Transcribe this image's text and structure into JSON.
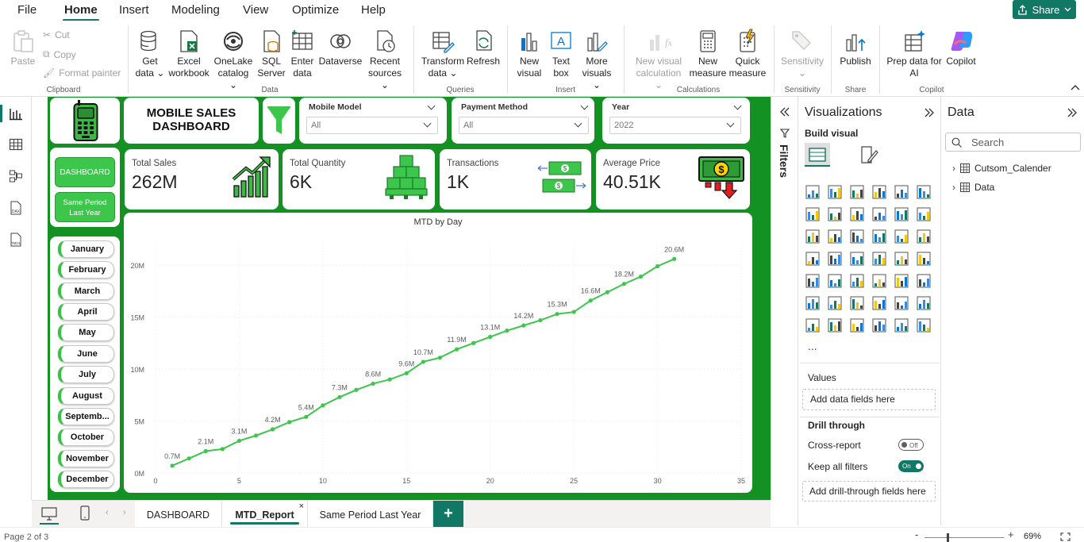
{
  "menu": {
    "items": [
      "File",
      "Home",
      "Insert",
      "Modeling",
      "View",
      "Optimize",
      "Help"
    ],
    "share_label": "Share"
  },
  "ribbon": {
    "clipboard": {
      "paste": "Paste",
      "cut": "Cut",
      "copy": "Copy",
      "format_painter": "Format painter",
      "label": "Clipboard"
    },
    "data": {
      "get_data": [
        "Get",
        "data"
      ],
      "excel": [
        "Excel",
        "workbook"
      ],
      "onelake": [
        "OneLake",
        "catalog"
      ],
      "sql": [
        "SQL",
        "Server"
      ],
      "enter": [
        "Enter",
        "data"
      ],
      "dataverse": [
        "Dataverse"
      ],
      "recent": [
        "Recent",
        "sources"
      ],
      "label": "Data"
    },
    "queries": {
      "transform": [
        "Transform",
        "data"
      ],
      "refresh": [
        "Refresh"
      ],
      "label": "Queries"
    },
    "insert": {
      "new_visual": [
        "New",
        "visual"
      ],
      "text_box": [
        "Text",
        "box"
      ],
      "more_visuals": [
        "More",
        "visuals"
      ],
      "label": "Insert"
    },
    "calculations": {
      "new_visual_calc": [
        "New visual",
        "calculation"
      ],
      "new_measure": [
        "New",
        "measure"
      ],
      "quick_measure": [
        "Quick",
        "measure"
      ],
      "label": "Calculations"
    },
    "sensitivity": {
      "btn": [
        "Sensitivity"
      ],
      "label": "Sensitivity"
    },
    "share": {
      "publish": [
        "Publish"
      ],
      "label": "Share"
    },
    "copilot": {
      "prep": [
        "Prep data for",
        "AI"
      ],
      "copilot": [
        "Copilot"
      ],
      "label": "Copilot"
    }
  },
  "dashboard": {
    "title_line1": "MOBILE SALES",
    "title_line2": "DASHBOARD",
    "slicers": [
      {
        "title": "Mobile Model",
        "value": "All"
      },
      {
        "title": "Payment Method",
        "value": "All"
      },
      {
        "title": "Year",
        "value": "2022"
      }
    ],
    "nav_buttons": {
      "dashboard": "DASHBOARD",
      "same_period_1": "Same Period",
      "same_period_2": "Last Year"
    },
    "kpis": [
      {
        "label": "Total Sales",
        "value": "262M"
      },
      {
        "label": "Total Quantity",
        "value": "6K"
      },
      {
        "label": "Transactions",
        "value": "1K"
      },
      {
        "label": "Average Price",
        "value": "40.51K"
      }
    ],
    "months": [
      "January",
      "February",
      "March",
      "April",
      "May",
      "June",
      "July",
      "August",
      "Septemb...",
      "October",
      "November",
      "December"
    ],
    "colors": {
      "accent": "#139122",
      "line": "#3cc64b",
      "button": "#3cc64b"
    }
  },
  "chart_data": {
    "type": "line",
    "title": "MTD by Day",
    "x": [
      1,
      2,
      3,
      4,
      5,
      6,
      7,
      8,
      9,
      10,
      11,
      12,
      13,
      14,
      15,
      16,
      17,
      18,
      19,
      20,
      21,
      22,
      23,
      24,
      25,
      26,
      27,
      28,
      29,
      30,
      31
    ],
    "series": [
      {
        "values": [
          0.7,
          1.4,
          2.1,
          2.3,
          3.1,
          3.6,
          4.2,
          4.9,
          5.4,
          6.5,
          7.3,
          8.0,
          8.6,
          9.0,
          9.6,
          10.7,
          11.1,
          11.9,
          12.5,
          13.1,
          13.7,
          14.2,
          14.7,
          15.3,
          15.5,
          16.6,
          17.4,
          18.2,
          18.9,
          19.9,
          20.6
        ]
      }
    ],
    "data_labels": {
      "1": "0.7M",
      "3": "2.1M",
      "5": "3.1M",
      "7": "4.2M",
      "9": "5.4M",
      "11": "7.3M",
      "13": "8.6M",
      "15": "9.6M",
      "16": "10.7M",
      "18": "11.9M",
      "20": "13.1M",
      "22": "14.2M",
      "24": "15.3M",
      "26": "16.6M",
      "28": "18.2M",
      "31": "20.6M"
    },
    "xlim": [
      0,
      35
    ],
    "ylim": [
      0,
      22
    ],
    "xticks": [
      0,
      5,
      10,
      15,
      20,
      25,
      30,
      35
    ],
    "yticks": [
      0,
      5,
      10,
      15,
      20
    ],
    "ytick_labels": [
      "0M",
      "5M",
      "10M",
      "15M",
      "20M"
    ],
    "grid": true
  },
  "filters_label": "Filters",
  "viz_pane": {
    "title": "Visualizations",
    "build_visual": "Build visual",
    "values_label": "Values",
    "add_fields": "Add data fields here",
    "drill_through": "Drill through",
    "cross_report": "Cross-report",
    "cross_report_state": "Off",
    "keep_filters": "Keep all filters",
    "keep_filters_state": "On",
    "add_drill": "Add drill-through fields here",
    "more": "..."
  },
  "data_pane": {
    "title": "Data",
    "search_placeholder": "Search",
    "tables": [
      "Cutsom_Calender",
      "Data"
    ]
  },
  "tabs": [
    {
      "label": "DASHBOARD",
      "active": false
    },
    {
      "label": "MTD_Report",
      "active": true
    },
    {
      "label": "Same Period Last Year",
      "active": false
    }
  ],
  "status": {
    "page": "Page 2 of 3",
    "zoom": "69%"
  }
}
